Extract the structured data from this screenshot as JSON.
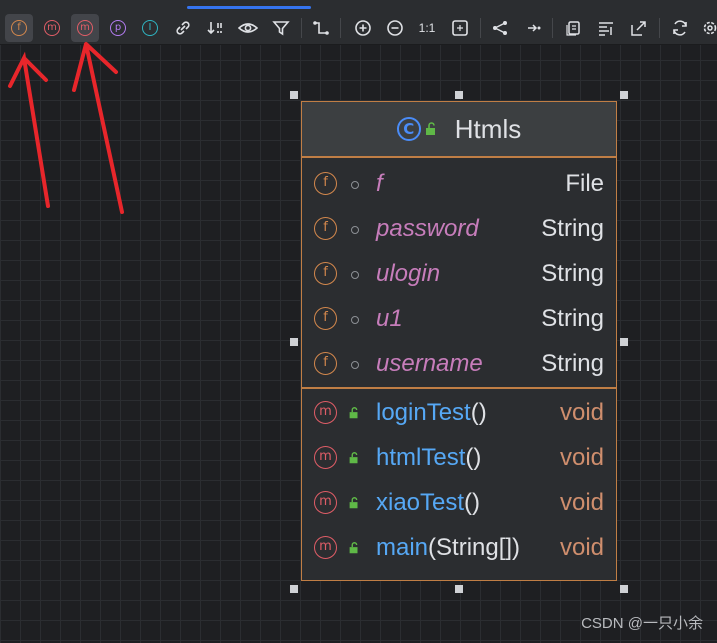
{
  "toolbar": {
    "zoom_label": "1:1",
    "buttons": [
      {
        "icon": "field-icon",
        "glyph": "f",
        "active": true
      },
      {
        "icon": "constructor-icon",
        "glyph": "m",
        "active": false
      },
      {
        "icon": "method-icon",
        "glyph": "m",
        "active": true
      },
      {
        "icon": "property-icon",
        "glyph": "p",
        "active": false
      },
      {
        "icon": "inner-class-icon",
        "glyph": "I",
        "active": false
      }
    ]
  },
  "class_node": {
    "name": "Htmls",
    "fields": [
      {
        "name": "f",
        "type": "File"
      },
      {
        "name": "password",
        "type": "String"
      },
      {
        "name": "ulogin",
        "type": "String"
      },
      {
        "name": "u1",
        "type": "String"
      },
      {
        "name": "username",
        "type": "String"
      }
    ],
    "methods": [
      {
        "name": "loginTest",
        "params": "()",
        "type": "void"
      },
      {
        "name": "htmlTest",
        "params": "()",
        "type": "void"
      },
      {
        "name": "xiaoTest",
        "params": "()",
        "type": "void"
      },
      {
        "name": "main",
        "params": "(String[])",
        "type": "void"
      }
    ]
  },
  "field_icon_glyph": "f",
  "method_icon_glyph": "m",
  "class_icon_glyph": "C",
  "watermark": "CSDN @一只小余",
  "colors": {
    "accent": "#3574f0",
    "border": "#c07e45",
    "field_name": "#c77dbb",
    "method_name": "#56a8f5",
    "return_type": "#cf8e6d",
    "annotation_arrow": "#e8262b"
  }
}
